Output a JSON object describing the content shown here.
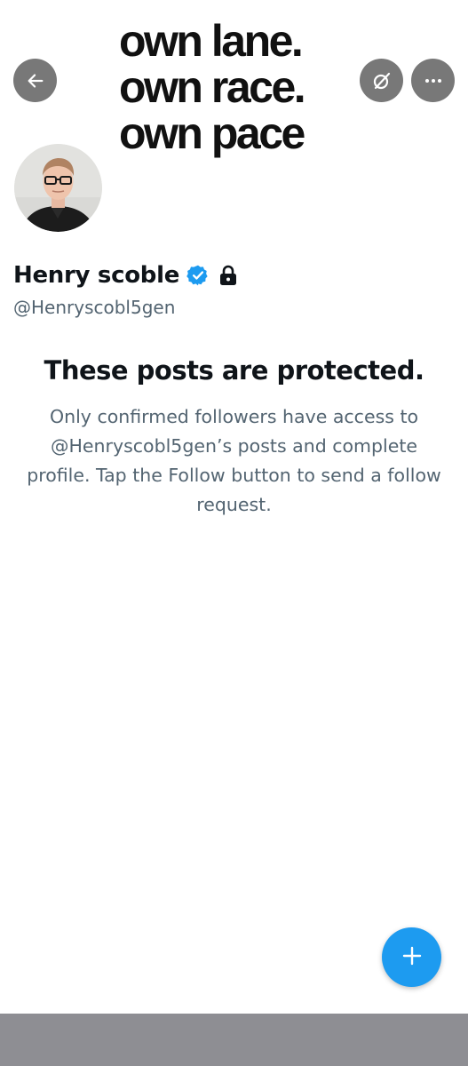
{
  "banner": {
    "lines": [
      "own lane.",
      "own race.",
      "own pace"
    ]
  },
  "header": {
    "back_icon": "arrow-left-icon",
    "grok_icon": "grok-icon",
    "more_icon": "more-horizontal-icon"
  },
  "profile": {
    "display_name": "Henry scoble",
    "handle": "@Henryscobl5gen",
    "verified": true,
    "protected": true,
    "verified_color": "#1d9bf0"
  },
  "protected_notice": {
    "title": "These posts are protected.",
    "body": "Only confirmed followers have access to @Henryscobl5gen’s posts and complete profile. Tap the Follow button to send a follow request."
  },
  "fab": {
    "icon": "plus-icon",
    "color": "#1d9bf0"
  },
  "colors": {
    "text_primary": "#0f1419",
    "text_secondary": "#536471",
    "header_button_bg": "#5a5a5a",
    "bottom_bar": "#8e8e93"
  }
}
